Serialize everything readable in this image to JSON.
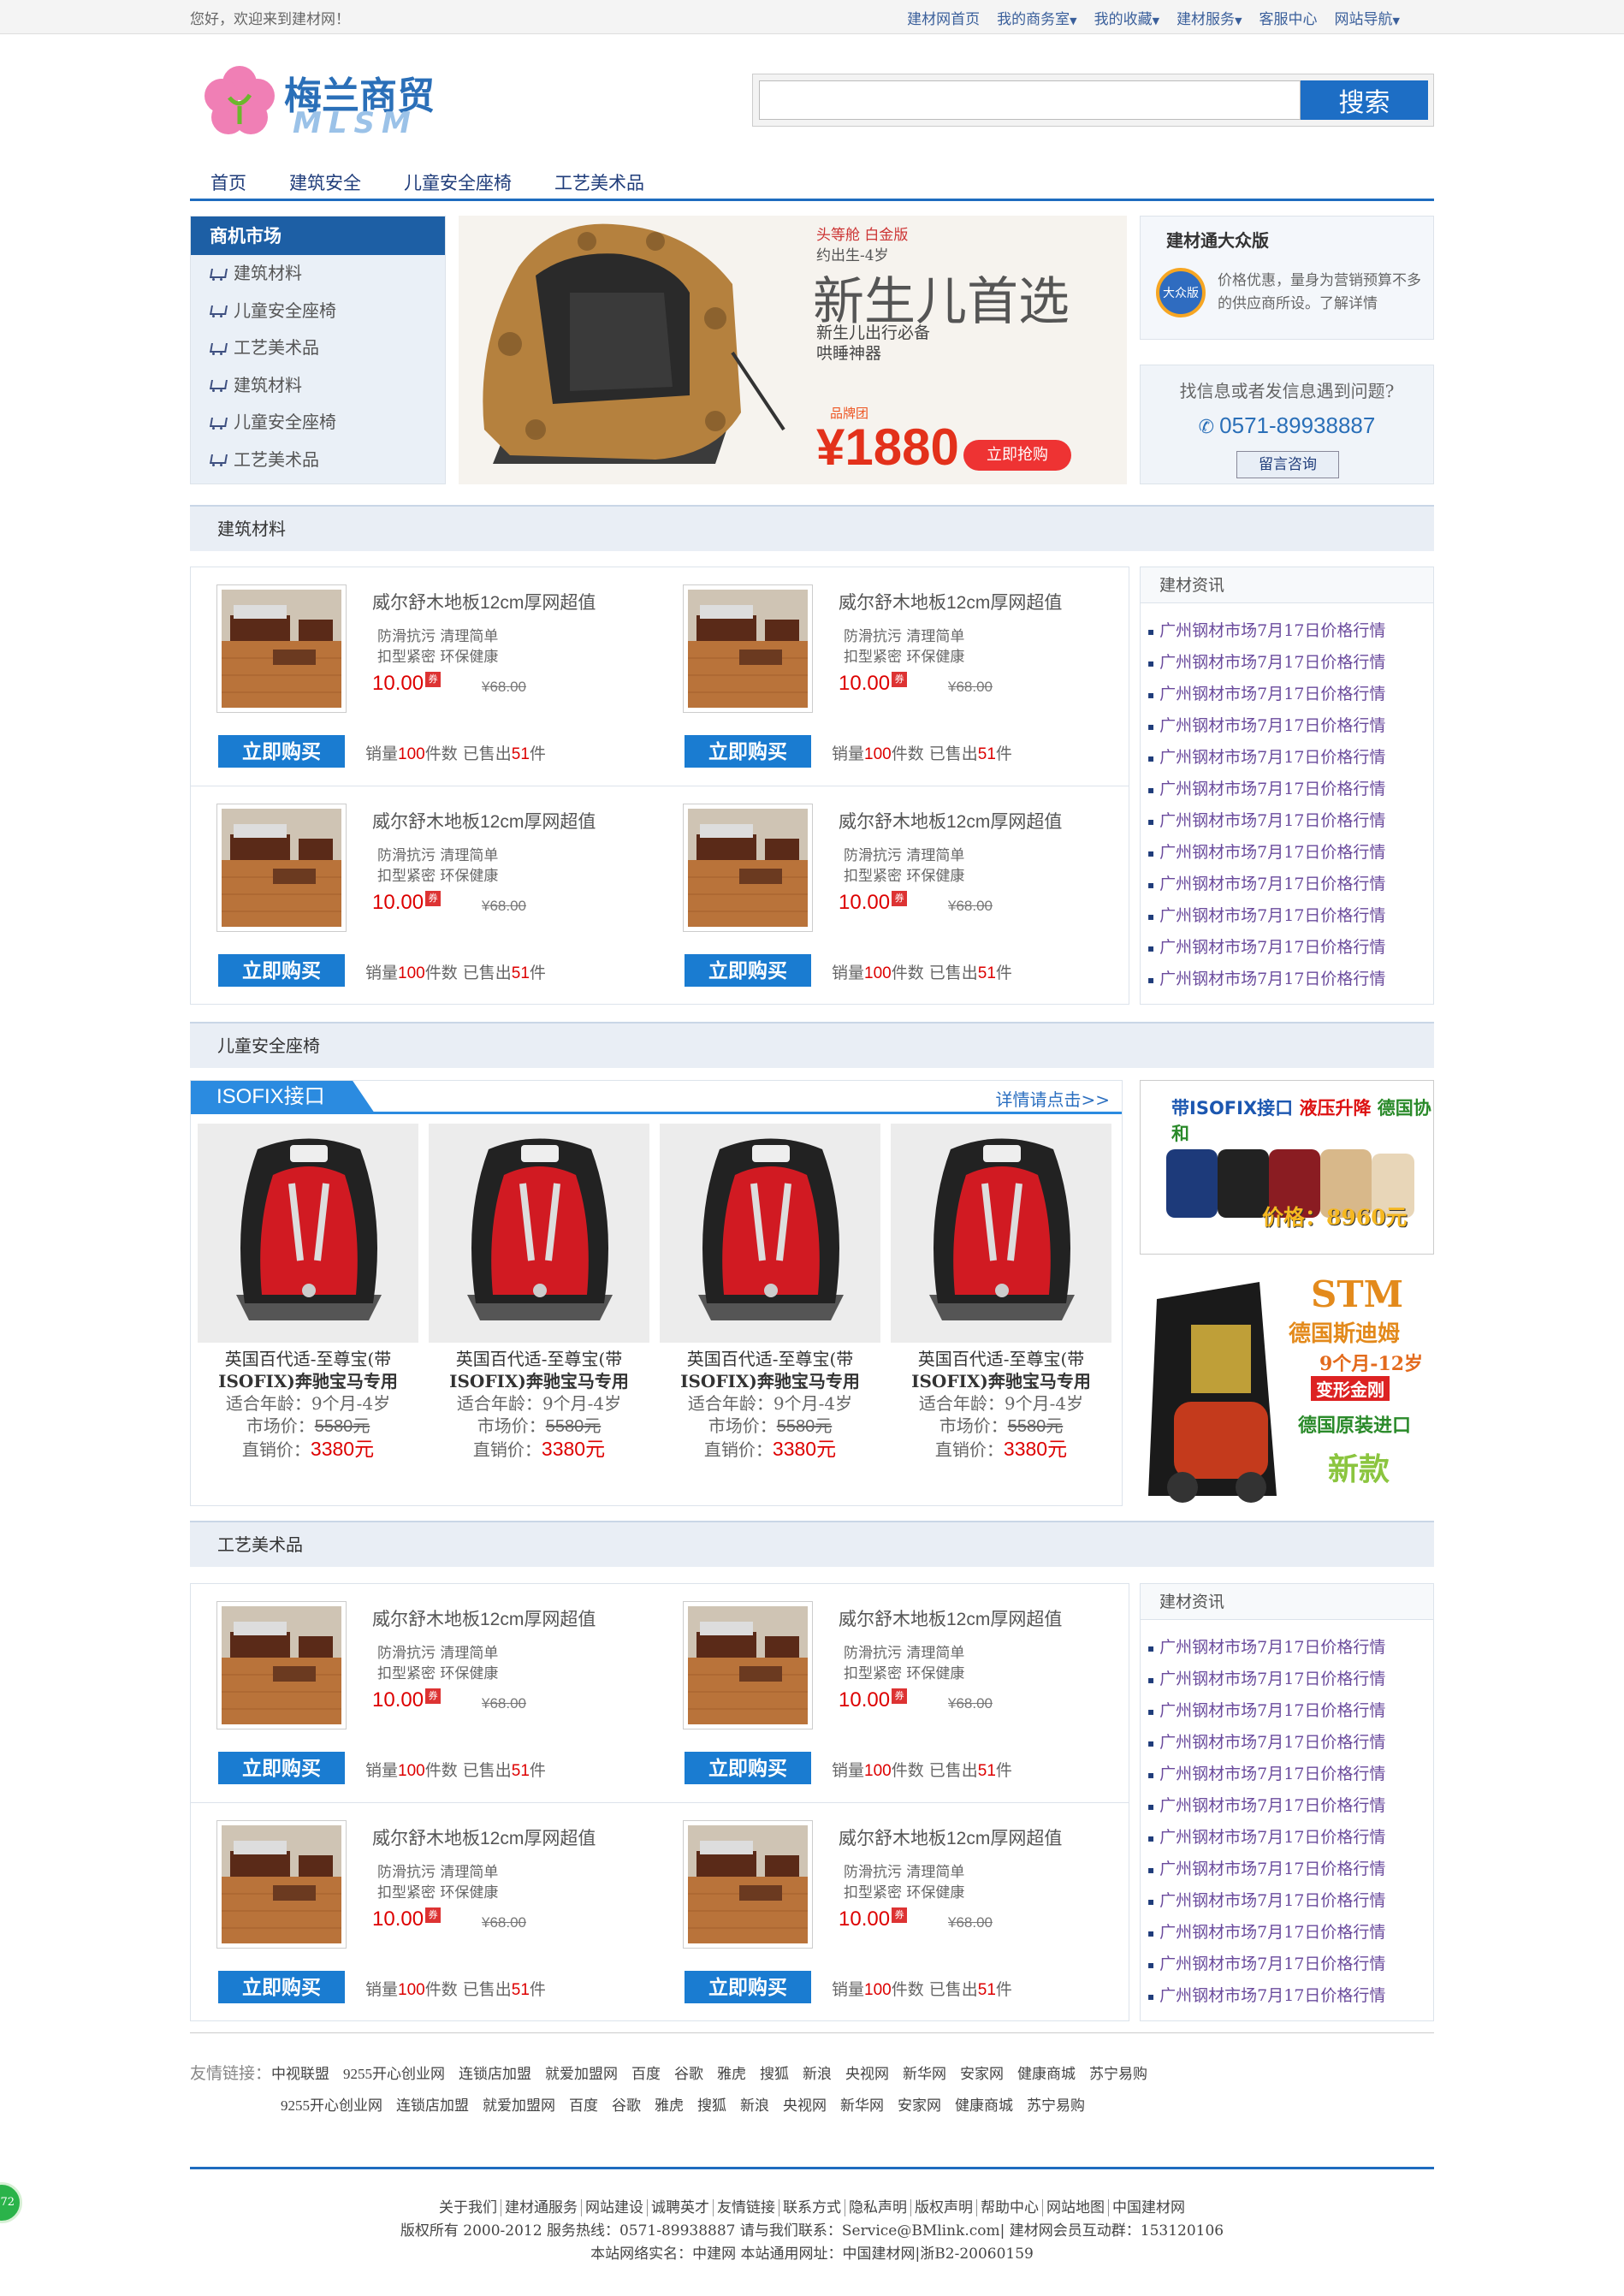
{
  "topbar": {
    "welcome": "您好，欢迎来到建材网！",
    "links": [
      "建材网首页",
      "我的商务室",
      "我的收藏",
      "建材服务",
      "客服中心",
      "网站导航"
    ]
  },
  "logo": {
    "cn": "梅兰商贸",
    "en": "MLSM"
  },
  "search": {
    "placeholder": "",
    "button": "搜索"
  },
  "nav": [
    "首页",
    "建筑安全",
    "儿童安全座椅",
    "工艺美术品"
  ],
  "market": {
    "title": "商机市场",
    "items": [
      "建筑材料",
      "儿童安全座椅",
      "工艺美术品",
      "建筑材料",
      "儿童安全座椅",
      "工艺美术品"
    ]
  },
  "banner": {
    "l1": "头等舱 白金版",
    "l2": "约出生-4岁",
    "big": "新生儿首选",
    "sub1": "新生儿出行必备",
    "sub2": "哄睡神器",
    "brand": "品牌团",
    "price": "¥1880",
    "btn": "立即抢购"
  },
  "dz": {
    "title": "建材通大众版",
    "icon": "大众版",
    "desc": "价格优惠，量身为营销预算不多的供应商所设。了解详情"
  },
  "help": {
    "q": "找信息或者发信息遇到问题?",
    "phone": "0571-89938887",
    "btn": "留言咨询"
  },
  "sections": {
    "s1": "建筑材料",
    "s2": "儿童安全座椅",
    "s3": "工艺美术品"
  },
  "product": {
    "title": "威尔舒木地板12cm厚网超值",
    "f1": "防滑抗污 清理简单",
    "f2": "扣型紧密 环保健康",
    "price": "10.00",
    "tag": "券",
    "old": "¥68.00",
    "buy": "立即购买",
    "s_pre": "销量",
    "s_n": "100",
    "s_mid": "件数 已售出",
    "s_n2": "51",
    "s_end": "件"
  },
  "news": {
    "title": "建材资讯",
    "item": "广州钢材市场7月17日价格行情"
  },
  "seats": {
    "tab": "ISOFIX接口",
    "more": "详情请点击>>",
    "name1": "英国百代适-至尊宝(带",
    "name2": "ISOFIX)奔驰宝马专用",
    "age_k": "适合年龄：",
    "age_v": "9个月-4岁",
    "mkt_k": "市场价：",
    "mkt_v": "5580元",
    "sell_k": "直销价：",
    "sell_v": "3380元"
  },
  "ad1": {
    "t1": "带ISOFIX接口",
    "t2": "液压升降",
    "t3": "德国协和",
    "price": "价格：8960元"
  },
  "ad2": {
    "t1": "STM",
    "t2": "德国斯迪姆",
    "t3": "9个月-12岁",
    "t4": "变形金刚",
    "t5": "德国原装进口",
    "t6": "新款"
  },
  "friend": {
    "label": "友情链接：",
    "items": [
      "中视联盟",
      "9255开心创业网",
      "连锁店加盟",
      "就爱加盟网",
      "百度",
      "谷歌",
      "雅虎",
      "搜狐",
      "新浪",
      "央视网",
      "新华网",
      "安家网",
      "健康商城",
      "苏宁易购",
      "9255开心创业网",
      "连锁店加盟",
      "就爱加盟网",
      "百度",
      "谷歌",
      "雅虎",
      "搜狐",
      "新浪",
      "央视网",
      "新华网",
      "安家网",
      "健康商城",
      "苏宁易购"
    ]
  },
  "footer": {
    "nav": [
      "关于我们",
      "建材通服务",
      "网站建设",
      "诚聘英才",
      "友情链接",
      "联系方式",
      "隐私声明",
      "版权声明",
      "帮助中心",
      "网站地图",
      "中国建材网"
    ],
    "l2": "版权所有 2000-2012 服务热线：0571-89938887 请与我们联系：Service@BMlink.com| 建材网会员互动群：153120106",
    "l3": "本站网络实名：中建网 本站通用网址：中国建材网|浙B2-20060159"
  },
  "fab": "72",
  "colors": {
    "accent": "#1e6cbf",
    "price": "#dd0000"
  }
}
